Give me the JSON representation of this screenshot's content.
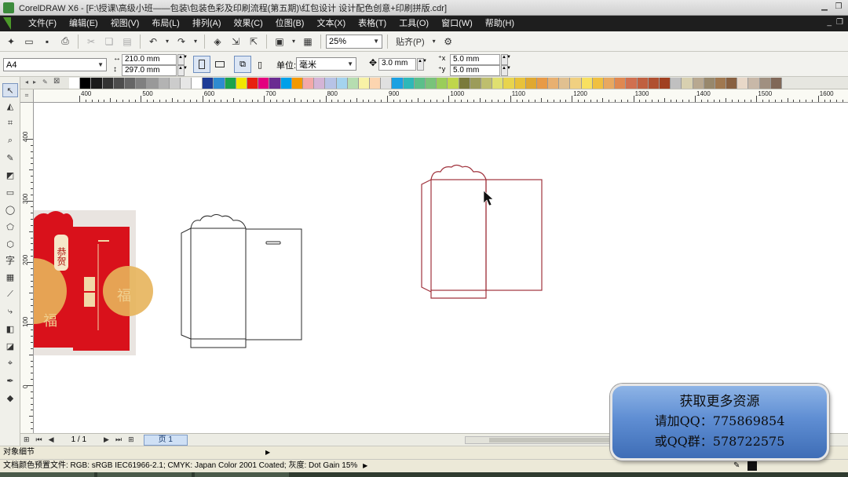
{
  "window": {
    "title": "CorelDRAW X6 - [F:\\授课\\高级小班——包装\\包装色彩及印刷流程(第五期)\\红包设计 设计配色创意+印刷拼版.cdr]"
  },
  "menu": [
    "文件(F)",
    "编辑(E)",
    "视图(V)",
    "布局(L)",
    "排列(A)",
    "效果(C)",
    "位图(B)",
    "文本(X)",
    "表格(T)",
    "工具(O)",
    "窗口(W)",
    "帮助(H)"
  ],
  "toolbar": {
    "zoom": "25%",
    "snap": "贴齐(P)"
  },
  "property_bar": {
    "paper_size": "A4",
    "width": "210.0 mm",
    "height": "297.0 mm",
    "units_label": "单位:",
    "units_value": "毫米",
    "nudge": "3.0 mm",
    "dup_x": "5.0 mm",
    "dup_y": "5.0 mm"
  },
  "palette_colors": [
    "#FFFFFF",
    "#000000",
    "#1A1A1A",
    "#333333",
    "#4D4D4D",
    "#666666",
    "#808080",
    "#999999",
    "#B3B3B3",
    "#CCCCCC",
    "#E6E6E6",
    "#FFFFFF",
    "#1E3C96",
    "#2E8BD0",
    "#1BA34B",
    "#F2E600",
    "#E8200F",
    "#E4007F",
    "#6A2C91",
    "#00A0E9",
    "#F39800",
    "#F3A8A8",
    "#D4B4D6",
    "#B7C3E6",
    "#A4D3EE",
    "#B6DDB0",
    "#F8F2A6",
    "#FCD5B0",
    "#E0E0E0",
    "#1BA1E2",
    "#2EB8B8",
    "#5BBF8A",
    "#79C37A",
    "#9ACD5A",
    "#BFD64B",
    "#7A7A3C",
    "#9C9C5A",
    "#BEBE6E",
    "#E0E070",
    "#E8D44D",
    "#E8C23A",
    "#E0A830",
    "#E89A46",
    "#E8B070",
    "#E0C090",
    "#F0D080",
    "#F8E060",
    "#F0C040",
    "#E8A860",
    "#E08850",
    "#D07050",
    "#C06040",
    "#B05030",
    "#A04020",
    "#C0C0C0",
    "#D8D0B0",
    "#B8A890",
    "#98886C",
    "#A07850",
    "#886040",
    "#E8D8C8",
    "#C8B8A8",
    "#A09080",
    "#806858"
  ],
  "ruler": {
    "h_ticks": [
      "400",
      "500",
      "600",
      "700",
      "800",
      "900",
      "1000",
      "1100",
      "1200",
      "1300",
      "1400",
      "1500",
      "1600"
    ],
    "v_ticks": [
      "400",
      "300",
      "200",
      "100",
      "0"
    ]
  },
  "page_nav": {
    "count": "1 / 1",
    "tab": "页 1"
  },
  "status": {
    "object_details": "对象细节",
    "color_profile": "文档颜色预置文件: RGB: sRGB IEC61966-2.1; CMYK: Japan Color 2001 Coated; 灰度: Dot Gain 15%"
  },
  "promo": {
    "line1": "获取更多资源",
    "line2": "请加QQ：775869854",
    "line3": "或QQ群：578722575"
  },
  "canvas_art": {
    "red_envelope_text": "恭贺",
    "accent_color": "#D9111B",
    "selection_color": "#A0323C"
  }
}
